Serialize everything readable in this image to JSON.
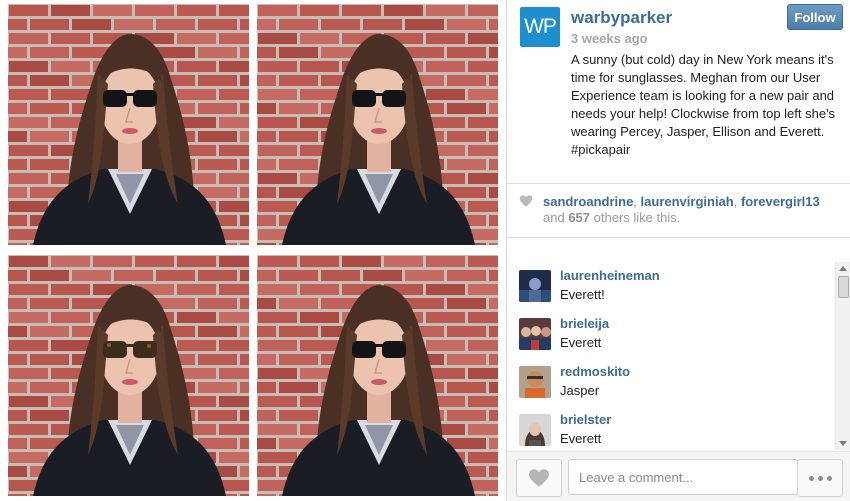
{
  "post": {
    "logo_text": "WP",
    "username": "warbyparker",
    "timestamp": "3 weeks ago",
    "follow_label": "Follow",
    "caption": "A sunny (but cold) day in New York means it's time for sunglasses. Meghan from our User Experience team is looking for a new pair and needs your help! Clockwise from top left she's wearing Percey, Jasper, Ellison and Everett. #pickapair"
  },
  "likes": {
    "users": [
      "sandroandrine",
      "laurenvirginiah",
      "forevergirl13"
    ],
    "prefix": "and",
    "count": "657",
    "suffix": "others like this."
  },
  "comments": [
    {
      "user": "laurenheineman",
      "text": "Everett!"
    },
    {
      "user": "brieleija",
      "text": "Everett"
    },
    {
      "user": "redmoskito",
      "text": "Jasper"
    },
    {
      "user": "brielster",
      "text": "Everett"
    }
  ],
  "footer": {
    "comment_placeholder": "Leave a comment..."
  },
  "colors": {
    "brand": "#1d8fcf",
    "link": "#3b6d99",
    "follow_button": "#5b88b3"
  },
  "icons": [
    "heart-icon",
    "more-dots-icon"
  ]
}
